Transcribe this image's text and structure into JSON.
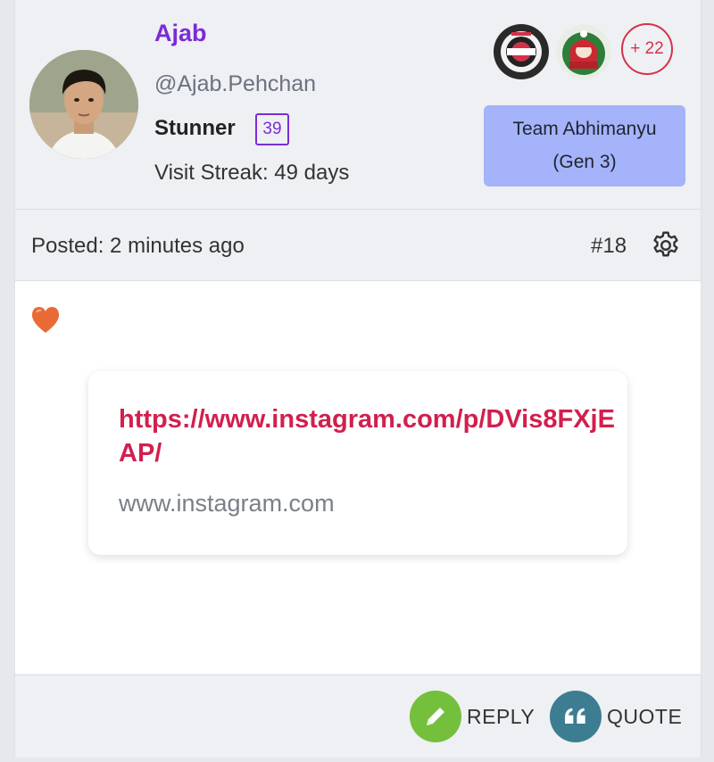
{
  "user": {
    "name": "Ajab",
    "handle": "@Ajab.Pehchan",
    "rank": "Stunner",
    "level": "39",
    "streak": "Visit Streak: 49 days"
  },
  "badges": {
    "extra_count": "+ 22"
  },
  "team": {
    "line1": "Team Abhimanyu",
    "line2": "(Gen 3)"
  },
  "post": {
    "posted": "Posted: 2 minutes ago",
    "number": "#18",
    "reaction_icon": "heart-icon",
    "link_url": "https://www.instagram.com/p/DVis8FXjEAP/",
    "link_domain": "www.instagram.com"
  },
  "actions": {
    "reply_label": "REPLY",
    "quote_label": "QUOTE"
  },
  "colors": {
    "username": "#7a2dd6",
    "link": "#d21f4e",
    "team_bg": "#a4b3fa",
    "reply": "#74bf3c",
    "quote": "#3c7d92",
    "badge_more": "#d4324a"
  }
}
